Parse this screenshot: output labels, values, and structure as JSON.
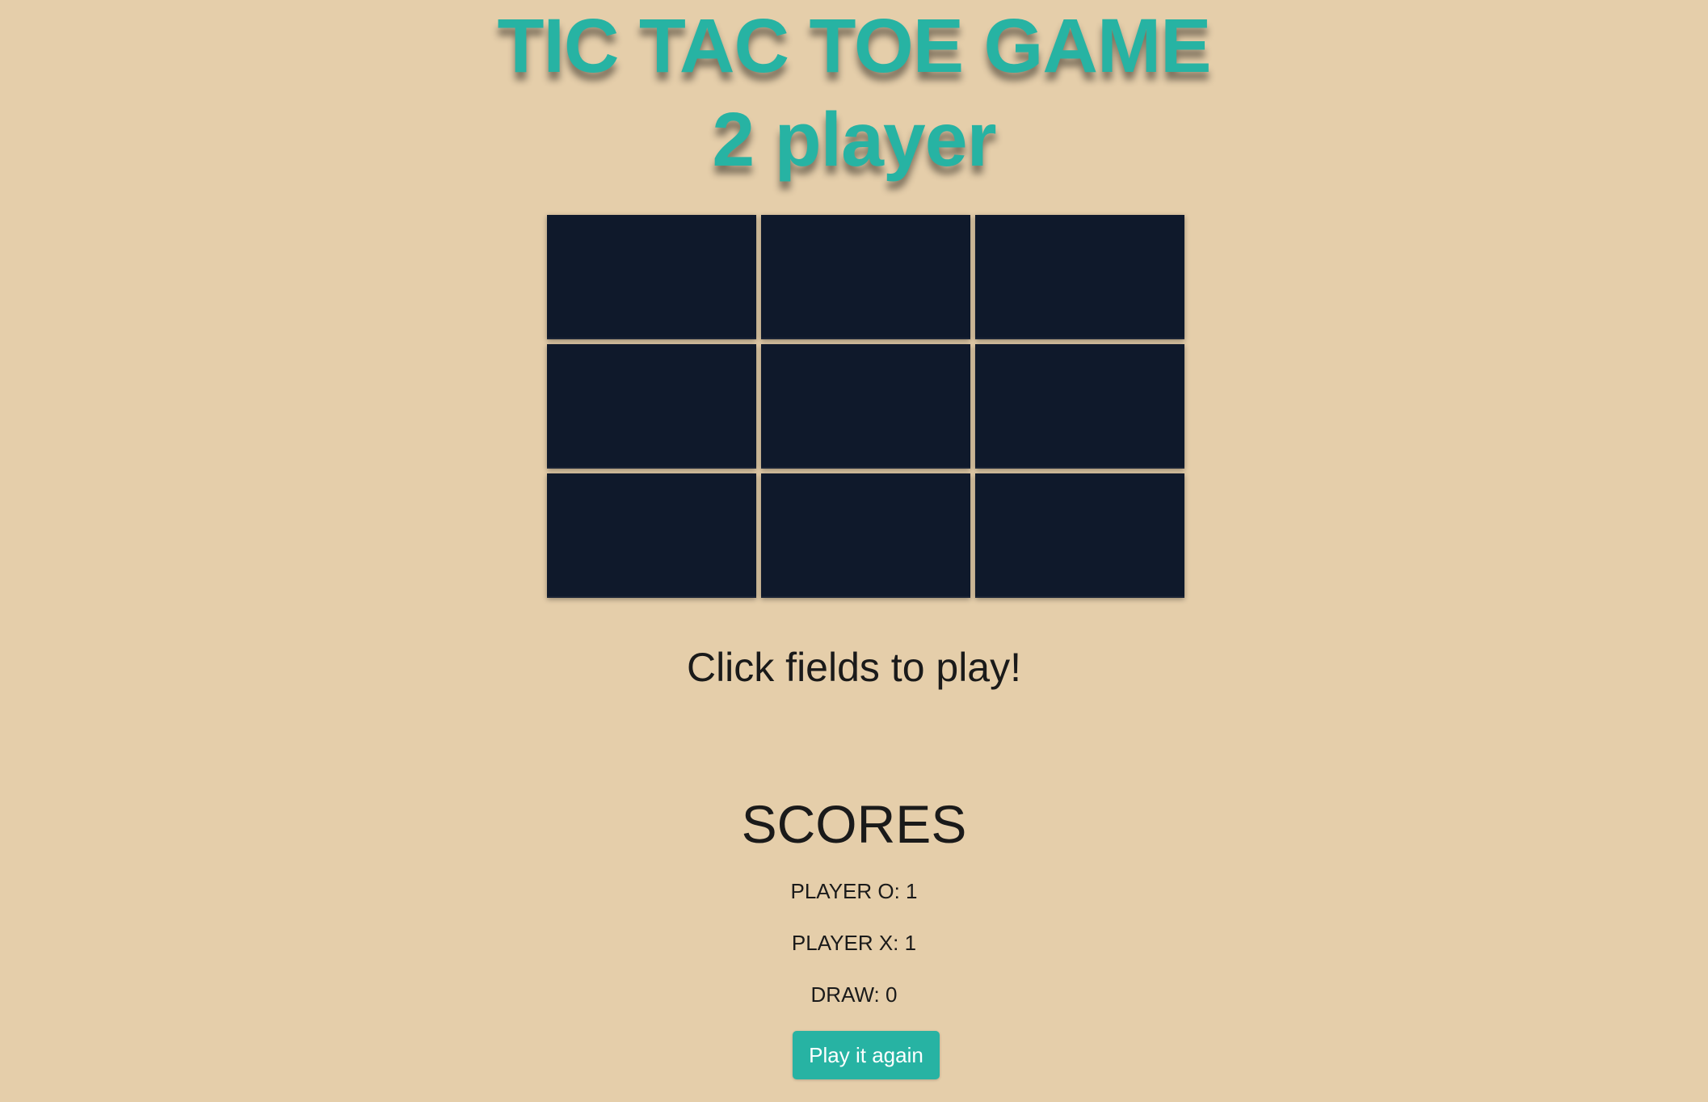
{
  "header": {
    "title_line1": "TIC TAC TOE GAME",
    "title_line2": "2 player"
  },
  "board": {
    "cells": [
      "",
      "",
      "",
      "",
      "",
      "",
      "",
      "",
      ""
    ]
  },
  "status": "Click fields to play!",
  "scores": {
    "heading": "SCORES",
    "player_o": "PLAYER O: 1",
    "player_x": "PLAYER X: 1",
    "draw": "DRAW: 0"
  },
  "actions": {
    "play_again_label": "Play it again"
  },
  "colors": {
    "background": "#e5ceaa",
    "accent": "#27b3a3",
    "cell": "#0f192b"
  }
}
